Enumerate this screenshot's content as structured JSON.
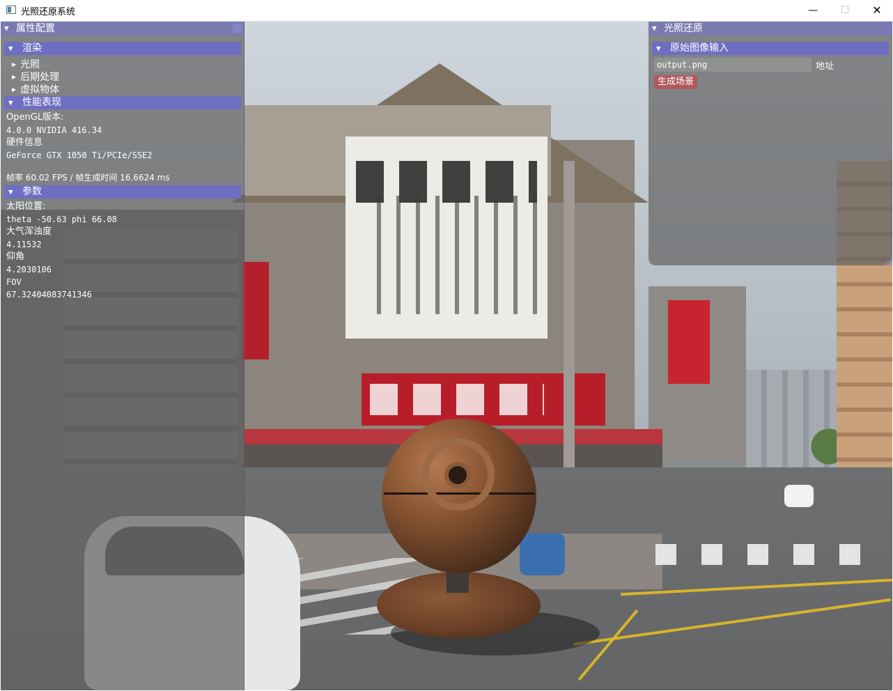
{
  "window": {
    "title": "光照还原系统",
    "minimize_glyph": "—",
    "maximize_glyph": "☐",
    "close_glyph": "✕"
  },
  "left_panel": {
    "title": "属性配置",
    "render_header": "渲染",
    "render_items": [
      "光照",
      "后期处理",
      "虚拟物体"
    ],
    "perf_header": "性能表现",
    "perf_lines": [
      "OpenGL版本:",
      "4.0.0 NVIDIA 416.34",
      "硬件信息",
      "GeForce GTX 1050 Ti/PCIe/SSE2",
      "帧率 60.02 FPS / 帧生成时间 16.6624 ms"
    ],
    "params_header": "参数",
    "params_lines": [
      "太阳位置:",
      "theta -50.63 phi 66.08",
      "大气浑浊度",
      "4.11532",
      "仰角",
      "4.2030106",
      "FOV",
      "67.32404083741346"
    ]
  },
  "right_panel": {
    "title": "光照还原",
    "source_header": "原始图像输入",
    "path_value": "output.png",
    "path_label": "地址",
    "generate_button": "生成场景"
  },
  "icons": {
    "collapse": "▼",
    "expand": "▶"
  },
  "colors": {
    "title_bar": "#7a7ab0",
    "header": "#6e6ec2",
    "button": "#b05a5e"
  }
}
